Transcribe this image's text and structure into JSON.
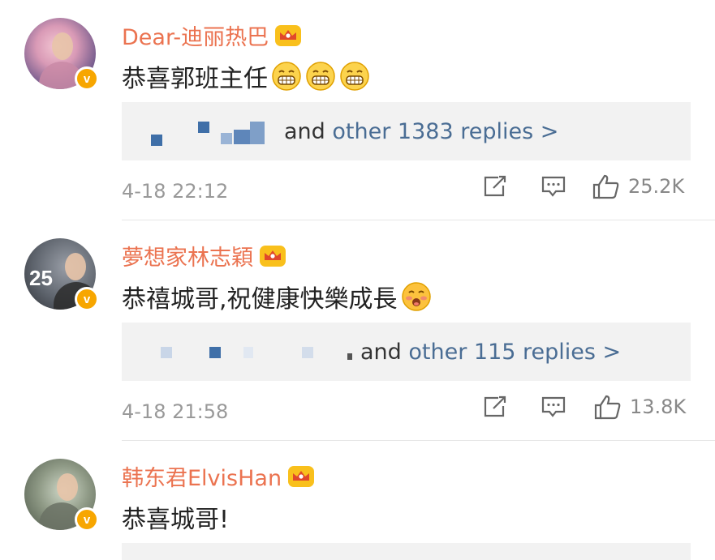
{
  "comments": [
    {
      "username": "Dear-迪丽热巴",
      "text": "恭喜郭班主任",
      "emoji_count": 3,
      "emoji_icon": "grin-emoji-icon",
      "reply_prefix": "and",
      "reply_link": "other 1383 replies >",
      "time": "4-18 22:12",
      "likes": "25.2K"
    },
    {
      "username": "夢想家林志穎",
      "text": "恭禧城哥,祝健康快樂成長",
      "emoji_count": 1,
      "emoji_icon": "blush-emoji-icon",
      "reply_prefix": "and",
      "reply_link": "other 115 replies >",
      "time": "4-18 21:58",
      "likes": "13.8K"
    },
    {
      "username": "韩东君ElvisHan",
      "text": "恭喜城哥!",
      "emoji_count": 0
    }
  ],
  "colors": {
    "username": "#eb7350",
    "link": "#4a6d94",
    "badge": "#f7a600",
    "meta": "#999999",
    "reply_bg": "#f2f2f2"
  },
  "icons": [
    "crown-icon",
    "verified-badge-icon",
    "repost-icon",
    "comment-icon",
    "thumbs-up-icon"
  ]
}
